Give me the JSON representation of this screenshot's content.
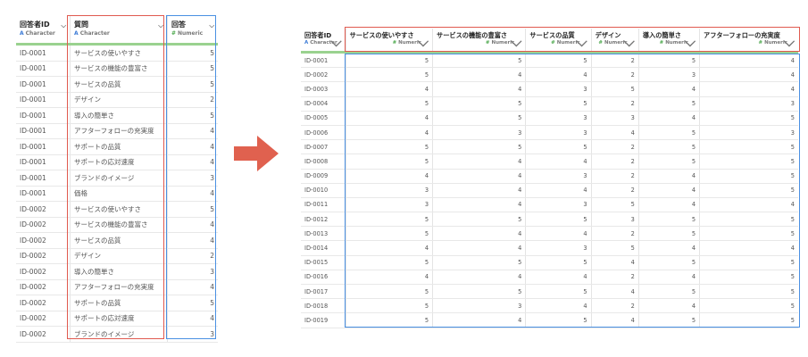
{
  "left_table": {
    "columns": [
      {
        "name": "回答者ID",
        "type": "Character",
        "type_icon": "A"
      },
      {
        "name": "質問",
        "type": "Character",
        "type_icon": "A"
      },
      {
        "name": "回答",
        "type": "Numeric",
        "type_icon": "#"
      }
    ],
    "rows": [
      [
        "ID-0001",
        "サービスの使いやすさ",
        "5"
      ],
      [
        "ID-0001",
        "サービスの機能の豊富さ",
        "5"
      ],
      [
        "ID-0001",
        "サービスの品質",
        "5"
      ],
      [
        "ID-0001",
        "デザイン",
        "2"
      ],
      [
        "ID-0001",
        "導入の簡単さ",
        "5"
      ],
      [
        "ID-0001",
        "アフターフォローの充実度",
        "4"
      ],
      [
        "ID-0001",
        "サポートの品質",
        "4"
      ],
      [
        "ID-0001",
        "サポートの応対速度",
        "4"
      ],
      [
        "ID-0001",
        "ブランドのイメージ",
        "3"
      ],
      [
        "ID-0001",
        "価格",
        "4"
      ],
      [
        "ID-0002",
        "サービスの使いやすさ",
        "5"
      ],
      [
        "ID-0002",
        "サービスの機能の豊富さ",
        "4"
      ],
      [
        "ID-0002",
        "サービスの品質",
        "4"
      ],
      [
        "ID-0002",
        "デザイン",
        "2"
      ],
      [
        "ID-0002",
        "導入の簡単さ",
        "3"
      ],
      [
        "ID-0002",
        "アフターフォローの充実度",
        "4"
      ],
      [
        "ID-0002",
        "サポートの品質",
        "5"
      ],
      [
        "ID-0002",
        "サポートの応対速度",
        "4"
      ],
      [
        "ID-0002",
        "ブランドのイメージ",
        "3"
      ]
    ]
  },
  "right_table": {
    "columns": [
      {
        "name": "回答者ID",
        "type": "Character",
        "type_icon": "A"
      },
      {
        "name": "サービスの使いやすさ",
        "type": "Numeric",
        "type_icon": "#"
      },
      {
        "name": "サービスの機能の豊富さ",
        "type": "Numeric",
        "type_icon": "#"
      },
      {
        "name": "サービスの品質",
        "type": "Numeric",
        "type_icon": "#"
      },
      {
        "name": "デザイン",
        "type": "Numeric",
        "type_icon": "#"
      },
      {
        "name": "導入の簡単さ",
        "type": "Numeric",
        "type_icon": "#"
      },
      {
        "name": "アフターフォローの充実度",
        "type": "Numeric",
        "type_icon": "#"
      }
    ],
    "rows": [
      [
        "ID-0001",
        "5",
        "5",
        "5",
        "2",
        "5",
        "4"
      ],
      [
        "ID-0002",
        "5",
        "4",
        "4",
        "2",
        "3",
        "4"
      ],
      [
        "ID-0003",
        "4",
        "4",
        "3",
        "5",
        "4",
        "4"
      ],
      [
        "ID-0004",
        "5",
        "5",
        "5",
        "2",
        "5",
        "3"
      ],
      [
        "ID-0005",
        "4",
        "5",
        "3",
        "3",
        "4",
        "5"
      ],
      [
        "ID-0006",
        "4",
        "3",
        "3",
        "4",
        "5",
        "3"
      ],
      [
        "ID-0007",
        "5",
        "5",
        "5",
        "2",
        "5",
        "5"
      ],
      [
        "ID-0008",
        "5",
        "4",
        "4",
        "2",
        "5",
        "5"
      ],
      [
        "ID-0009",
        "4",
        "4",
        "3",
        "2",
        "4",
        "5"
      ],
      [
        "ID-0010",
        "3",
        "4",
        "4",
        "2",
        "4",
        "5"
      ],
      [
        "ID-0011",
        "3",
        "4",
        "3",
        "5",
        "4",
        "4"
      ],
      [
        "ID-0012",
        "5",
        "5",
        "5",
        "3",
        "5",
        "5"
      ],
      [
        "ID-0013",
        "5",
        "4",
        "4",
        "2",
        "5",
        "5"
      ],
      [
        "ID-0014",
        "4",
        "4",
        "3",
        "5",
        "4",
        "4"
      ],
      [
        "ID-0015",
        "5",
        "5",
        "5",
        "4",
        "5",
        "5"
      ],
      [
        "ID-0016",
        "4",
        "4",
        "4",
        "2",
        "4",
        "5"
      ],
      [
        "ID-0017",
        "5",
        "5",
        "5",
        "4",
        "5",
        "5"
      ],
      [
        "ID-0018",
        "5",
        "3",
        "4",
        "2",
        "4",
        "5"
      ],
      [
        "ID-0019",
        "5",
        "4",
        "5",
        "4",
        "5",
        "5"
      ]
    ]
  },
  "colors": {
    "highlight_red": "#e05a4f",
    "highlight_blue": "#4a90e2",
    "arrow": "#e0614f",
    "header_underline": "#9ad28f",
    "character_icon": "#3c7bd6",
    "numeric_icon": "#4aa74a"
  },
  "icons": {
    "column_menu": "chevron-down-icon",
    "arrow": "right-arrow-icon"
  }
}
